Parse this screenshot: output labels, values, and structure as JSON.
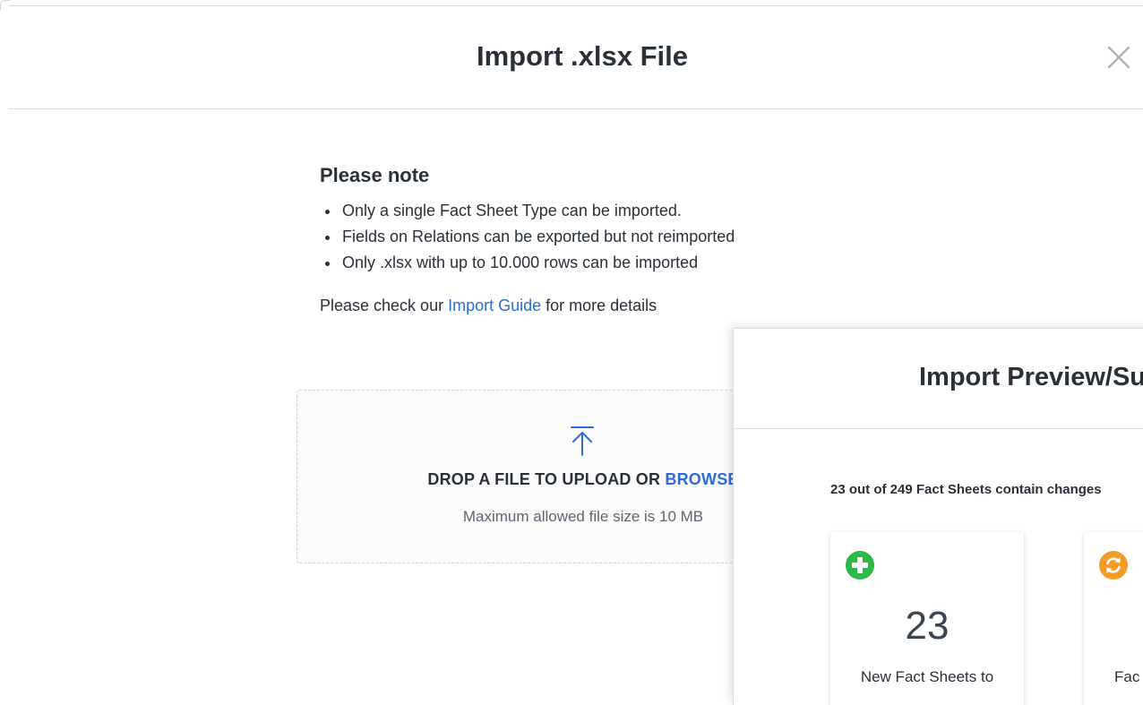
{
  "import_dialog": {
    "title": "Import .xlsx File",
    "note_title": "Please note",
    "note_items": [
      "Only a single Fact Sheet Type can be imported.",
      "Fields on Relations can be exported but not reimported",
      "Only .xlsx with up to 10.000 rows can be imported"
    ],
    "guide_prefix": "Please check our ",
    "guide_link": "Import Guide",
    "guide_suffix": " for more details",
    "dropzone": {
      "text": "DROP A FILE TO UPLOAD OR ",
      "browse": "BROWSE",
      "size_note": "Maximum allowed file size is 10 MB"
    }
  },
  "preview_dialog": {
    "title": "Import Preview/Summary",
    "summary": "23 out of 249 Fact Sheets contain changes",
    "cards": [
      {
        "icon": "plus-circle-icon",
        "color": "#2eb84a",
        "count": "23",
        "label": "New Fact Sheets to"
      },
      {
        "icon": "refresh-circle-icon",
        "color": "#f39c26",
        "count": "",
        "label": "Fac"
      }
    ]
  },
  "colors": {
    "accent": "#2b6fd6",
    "text": "#2a3038",
    "green": "#2eb84a",
    "orange": "#f39c26"
  }
}
